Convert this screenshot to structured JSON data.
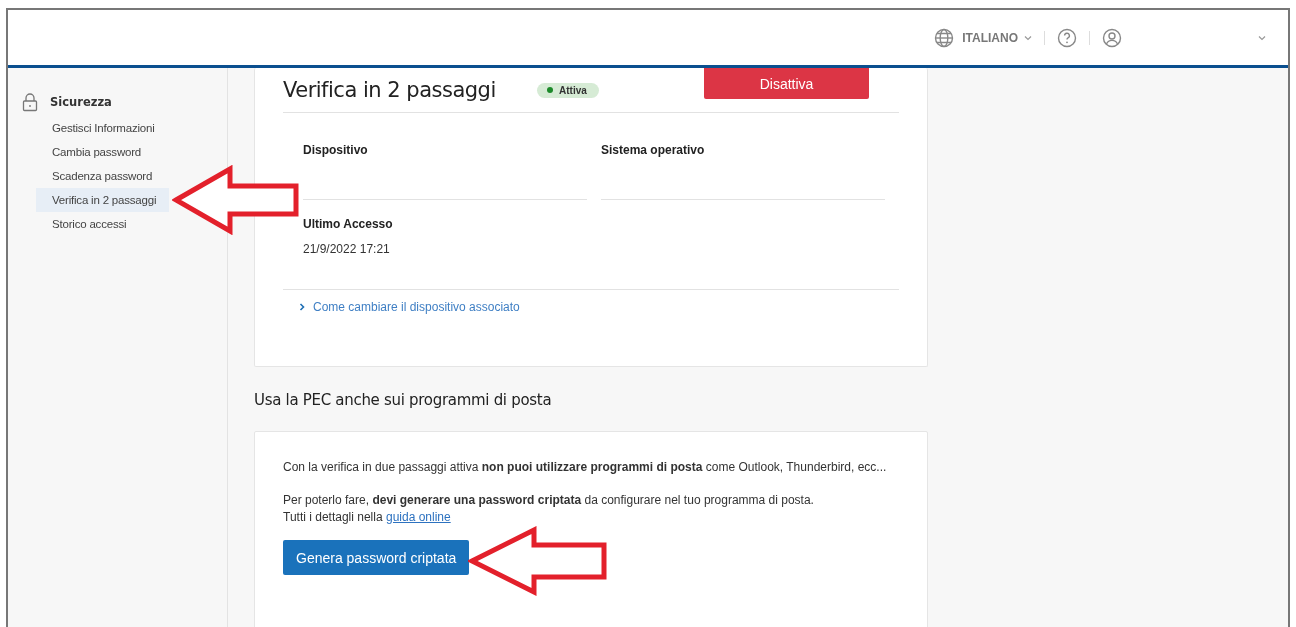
{
  "header": {
    "language": "ITALIANO"
  },
  "sidebar": {
    "section": "Sicurezza",
    "items": [
      {
        "label": "Gestisci Informazioni",
        "selected": false
      },
      {
        "label": "Cambia password",
        "selected": false
      },
      {
        "label": "Scadenza password",
        "selected": false
      },
      {
        "label": "Verifica in 2 passaggi",
        "selected": true
      },
      {
        "label": "Storico accessi",
        "selected": false
      }
    ]
  },
  "two_step_card": {
    "title": "Verifica in 2 passaggi",
    "status": "Attiva",
    "button": "Disattiva",
    "fields": [
      {
        "label": "Dispositivo"
      },
      {
        "label": "Sistema operativo"
      }
    ],
    "last_access": {
      "label": "Ultimo Accesso",
      "value": "21/9/2022 17:21"
    },
    "link": "Come cambiare il dispositivo associato"
  },
  "mail_section": {
    "heading": "Usa la PEC anche sui programmi di posta",
    "paragraphs": [
      "Con la verifica in due passaggi attiva **non puoi utilizzare programmi di posta** come Outlook, Thunderbird, ecc...",
      "Per poterlo fare, **devi generare una password criptata** da configurare nel tuo programma di posta."
    ],
    "details": {
      "text": "Tutti i dettagli nella",
      "link": "guida online"
    },
    "button": "Genera password criptata"
  }
}
